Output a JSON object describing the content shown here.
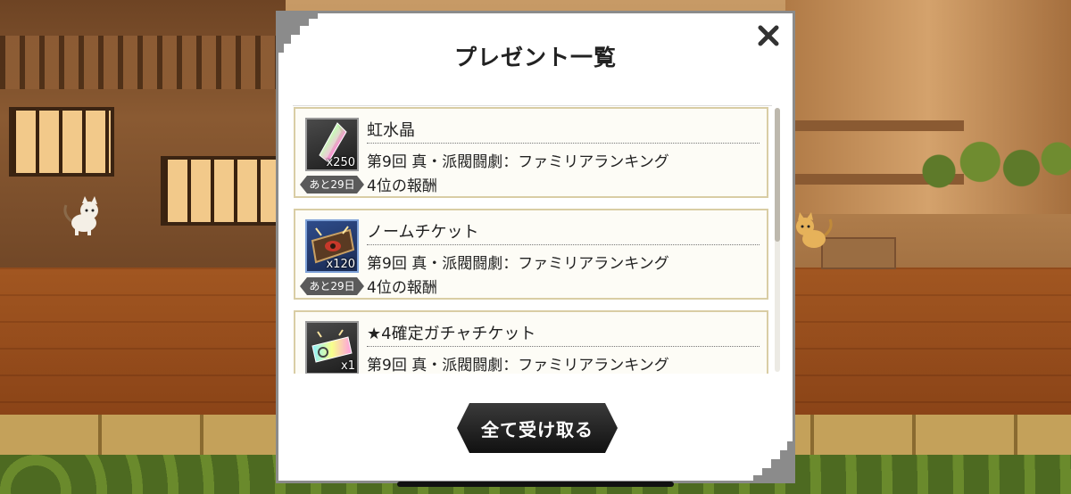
{
  "modal": {
    "title": "プレゼント一覧",
    "close_icon": "close-x-icon",
    "receive_all_label": "全て受け取る"
  },
  "presents": [
    {
      "name": "虹水晶",
      "quantity": "x250",
      "remaining": "あと29日",
      "desc_line1": "第9回 真・派閥闘劇：ファミリアランキング",
      "desc_line2": "4位の報酬",
      "icon": "rainbow-crystal-icon"
    },
    {
      "name": "ノームチケット",
      "quantity": "x120",
      "remaining": "あと29日",
      "desc_line1": "第9回 真・派閥闘劇：ファミリアランキング",
      "desc_line2": "4位の報酬",
      "icon": "gnome-ticket-icon"
    },
    {
      "name": "★4確定ガチャチケット",
      "quantity": "x1",
      "remaining": "",
      "desc_line1": "第9回 真・派閥闘劇：ファミリアランキング",
      "desc_line2": "",
      "icon": "gacha-ticket-icon"
    }
  ],
  "colors": {
    "item_border": "#d9cda4",
    "button_bg": "#1a1a1a",
    "modal_border": "#8b8b8b"
  }
}
